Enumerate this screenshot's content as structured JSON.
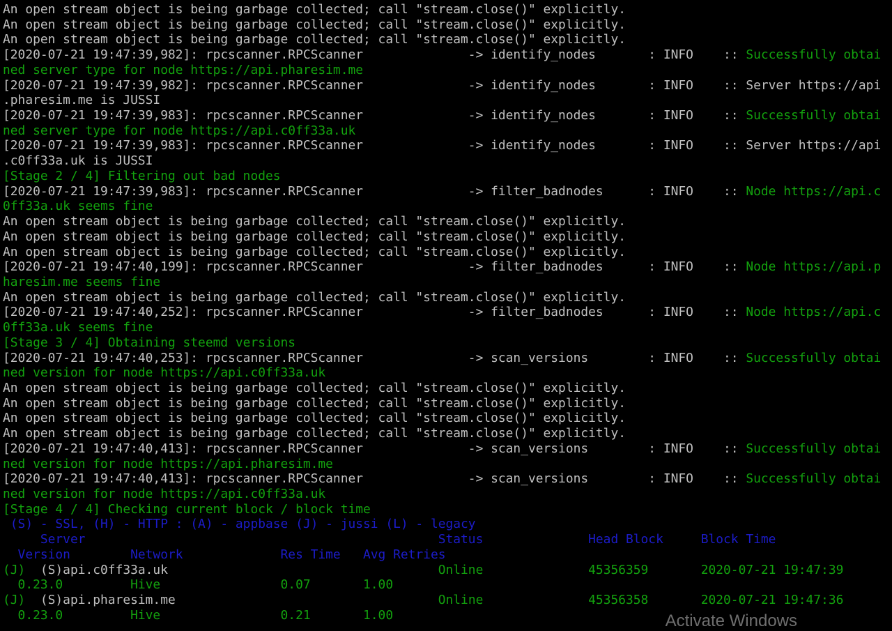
{
  "colors": {
    "background": "#000000",
    "default_text": "#c0c0c0",
    "success_green": "#13a10e",
    "header_blue": "#1c1cc8"
  },
  "terminal": {
    "lines": [
      [
        {
          "t": "An open stream object is being garbage collected; call \"stream.close()\" explicitly.",
          "c": "gray"
        }
      ],
      [
        {
          "t": "An open stream object is being garbage collected; call \"stream.close()\" explicitly.",
          "c": "gray"
        }
      ],
      [
        {
          "t": "An open stream object is being garbage collected; call \"stream.close()\" explicitly.",
          "c": "gray"
        }
      ],
      [
        {
          "t": "[2020-07-21 19:47:39,982]: rpcscanner.RPCScanner              -> identify_nodes       : INFO    :: ",
          "c": "gray"
        },
        {
          "t": "Successfully obtai",
          "c": "green"
        }
      ],
      [
        {
          "t": "ned server type for node https://api.pharesim.me",
          "c": "green"
        }
      ],
      [
        {
          "t": "[2020-07-21 19:47:39,982]: rpcscanner.RPCScanner              -> identify_nodes       : INFO    :: Server https://api",
          "c": "gray"
        }
      ],
      [
        {
          "t": ".pharesim.me is JUSSI",
          "c": "gray"
        }
      ],
      [
        {
          "t": "[2020-07-21 19:47:39,983]: rpcscanner.RPCScanner              -> identify_nodes       : INFO    :: ",
          "c": "gray"
        },
        {
          "t": "Successfully obtai",
          "c": "green"
        }
      ],
      [
        {
          "t": "ned server type for node https://api.c0ff33a.uk",
          "c": "green"
        }
      ],
      [
        {
          "t": "[2020-07-21 19:47:39,983]: rpcscanner.RPCScanner              -> identify_nodes       : INFO    :: Server https://api",
          "c": "gray"
        }
      ],
      [
        {
          "t": ".c0ff33a.uk is JUSSI",
          "c": "gray"
        }
      ],
      [
        {
          "t": "[Stage 2 / 4] Filtering out bad nodes",
          "c": "green"
        }
      ],
      [
        {
          "t": "[2020-07-21 19:47:39,983]: rpcscanner.RPCScanner              -> filter_badnodes      : INFO    :: ",
          "c": "gray"
        },
        {
          "t": "Node https://api.c",
          "c": "green"
        }
      ],
      [
        {
          "t": "0ff33a.uk seems fine",
          "c": "green"
        }
      ],
      [
        {
          "t": "An open stream object is being garbage collected; call \"stream.close()\" explicitly.",
          "c": "gray"
        }
      ],
      [
        {
          "t": "An open stream object is being garbage collected; call \"stream.close()\" explicitly.",
          "c": "gray"
        }
      ],
      [
        {
          "t": "An open stream object is being garbage collected; call \"stream.close()\" explicitly.",
          "c": "gray"
        }
      ],
      [
        {
          "t": "[2020-07-21 19:47:40,199]: rpcscanner.RPCScanner              -> filter_badnodes      : INFO    :: ",
          "c": "gray"
        },
        {
          "t": "Node https://api.p",
          "c": "green"
        }
      ],
      [
        {
          "t": "haresim.me seems fine",
          "c": "green"
        }
      ],
      [
        {
          "t": "An open stream object is being garbage collected; call \"stream.close()\" explicitly.",
          "c": "gray"
        }
      ],
      [
        {
          "t": "[2020-07-21 19:47:40,252]: rpcscanner.RPCScanner              -> filter_badnodes      : INFO    :: ",
          "c": "gray"
        },
        {
          "t": "Node https://api.c",
          "c": "green"
        }
      ],
      [
        {
          "t": "0ff33a.uk seems fine",
          "c": "green"
        }
      ],
      [
        {
          "t": "[Stage 3 / 4] Obtaining steemd versions",
          "c": "green"
        }
      ],
      [
        {
          "t": "[2020-07-21 19:47:40,253]: rpcscanner.RPCScanner              -> scan_versions        : INFO    :: ",
          "c": "gray"
        },
        {
          "t": "Successfully obtai",
          "c": "green"
        }
      ],
      [
        {
          "t": "ned version for node https://api.c0ff33a.uk",
          "c": "green"
        }
      ],
      [
        {
          "t": "An open stream object is being garbage collected; call \"stream.close()\" explicitly.",
          "c": "gray"
        }
      ],
      [
        {
          "t": "An open stream object is being garbage collected; call \"stream.close()\" explicitly.",
          "c": "gray"
        }
      ],
      [
        {
          "t": "An open stream object is being garbage collected; call \"stream.close()\" explicitly.",
          "c": "gray"
        }
      ],
      [
        {
          "t": "An open stream object is being garbage collected; call \"stream.close()\" explicitly.",
          "c": "gray"
        }
      ],
      [
        {
          "t": "[2020-07-21 19:47:40,413]: rpcscanner.RPCScanner              -> scan_versions        : INFO    :: ",
          "c": "gray"
        },
        {
          "t": "Successfully obtai",
          "c": "green"
        }
      ],
      [
        {
          "t": "ned version for node https://api.pharesim.me",
          "c": "green"
        }
      ],
      [
        {
          "t": "[2020-07-21 19:47:40,413]: rpcscanner.RPCScanner              -> scan_versions        : INFO    :: ",
          "c": "gray"
        },
        {
          "t": "Successfully obtai",
          "c": "green"
        }
      ],
      [
        {
          "t": "ned version for node https://api.c0ff33a.uk",
          "c": "green"
        }
      ],
      [
        {
          "t": "[Stage 4 / 4] Checking current block / block time",
          "c": "green"
        }
      ],
      [
        {
          "t": " (S) - SSL, (H) - HTTP : (A) - appbase (J) - jussi (L) - legacy",
          "c": "blue"
        }
      ],
      [
        {
          "t": "     Server                                               Status              Head Block     Block Time",
          "c": "blue"
        }
      ],
      [
        {
          "t": "  Version        Network             Res Time   Avg Retries",
          "c": "blue"
        }
      ],
      [
        {
          "t": "(J)  ",
          "c": "green"
        },
        {
          "t": "(S)api.c0ff33a.uk",
          "c": "gray"
        },
        {
          "t": "                                    Online              45356359       2020-07-21 19:47:39",
          "c": "green"
        }
      ],
      [
        {
          "t": "  0.23.0         Hive                0.07       1.00",
          "c": "green"
        }
      ],
      [
        {
          "t": "(J)  ",
          "c": "green"
        },
        {
          "t": "(S)api.pharesim.me",
          "c": "gray"
        },
        {
          "t": "                                   Online              45356358       2020-07-21 19:47:36",
          "c": "green"
        }
      ],
      [
        {
          "t": "  0.23.0         Hive                0.21       1.00",
          "c": "green"
        }
      ]
    ]
  },
  "watermark": {
    "text": "Activate Windows"
  }
}
